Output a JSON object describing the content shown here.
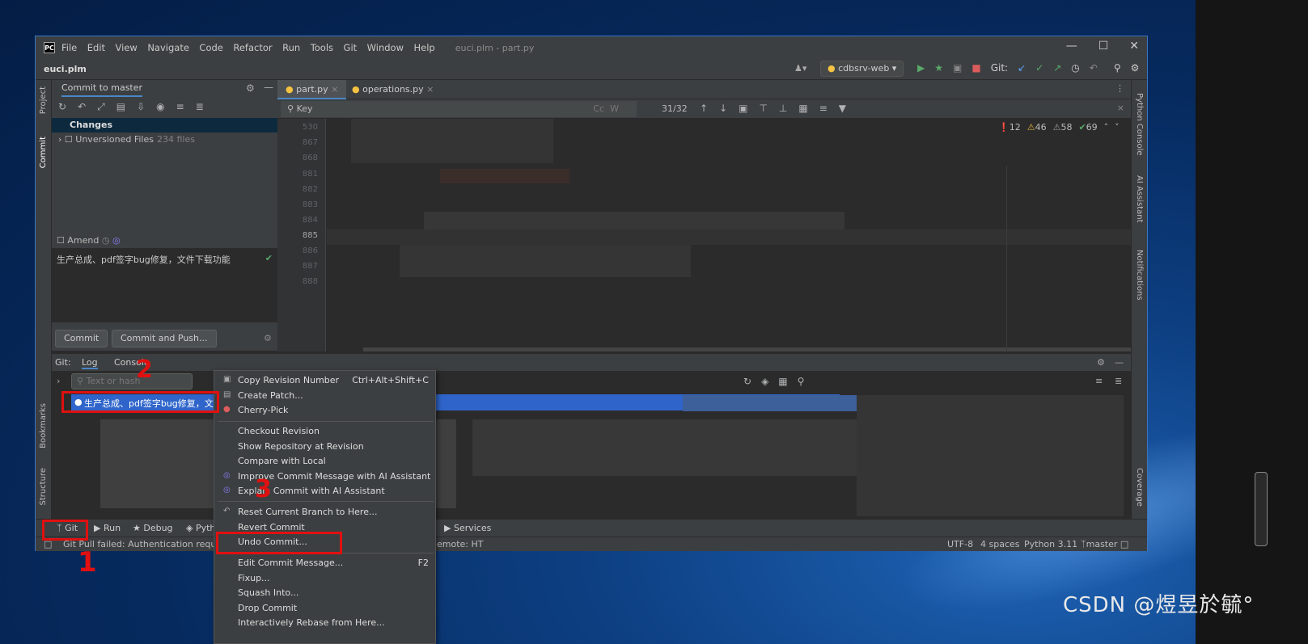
{
  "window": {
    "title": "euci.plm - part.py",
    "menu": [
      "File",
      "Edit",
      "View",
      "Navigate",
      "Code",
      "Refactor",
      "Run",
      "Tools",
      "Git",
      "Window",
      "Help"
    ]
  },
  "nav": {
    "project": "euci.plm",
    "run_config": "cdbsrv-web",
    "git_label": "Git:"
  },
  "commit": {
    "panel_title": "Commit to master",
    "changes_label": "Changes",
    "unversioned_label": "Unversioned Files",
    "unversioned_count": "234 files",
    "amend_label": "Amend",
    "message": "生产总成、pdf签字bug修复，文件下载功能",
    "commit_btn": "Commit",
    "commit_push_btn": "Commit and Push..."
  },
  "left_stripe": {
    "project": "Project",
    "commit": "Commit",
    "bookmarks": "Bookmarks",
    "structure": "Structure"
  },
  "right_stripe": {
    "python_console": "Python Console",
    "ai": "AI Assistant",
    "notifications": "Notifications",
    "coverage": "Coverage"
  },
  "editor": {
    "tabs": [
      "part.py",
      "operations.py"
    ],
    "search_text": "Key",
    "search_count": "31/32",
    "line_numbers": [
      "530",
      "867",
      "868",
      "881",
      "882",
      "883",
      "884",
      "885",
      "886",
      "887",
      "888"
    ],
    "errors": "12",
    "warnings": "46",
    "weak": "58",
    "ok": "69"
  },
  "git": {
    "label": "Git:",
    "tab_log": "Log",
    "tab_console": "Console",
    "filter_placeholder": "Text or hash",
    "selected_commit": "生产总成、pdf签字bug修复，文"
  },
  "context_menu": {
    "items": [
      {
        "label": "Copy Revision Number",
        "shortcut": "Ctrl+Alt+Shift+C",
        "icon": "copy-icon"
      },
      {
        "label": "Create Patch...",
        "shortcut": "",
        "icon": "patch-icon"
      },
      {
        "label": "Cherry-Pick",
        "shortcut": "",
        "icon": "cherry-icon"
      },
      {
        "label": "Checkout Revision",
        "shortcut": "",
        "icon": ""
      },
      {
        "label": "Show Repository at Revision",
        "shortcut": "",
        "icon": ""
      },
      {
        "label": "Compare with Local",
        "shortcut": "",
        "icon": ""
      },
      {
        "label": "Improve Commit Message with AI Assistant",
        "shortcut": "",
        "icon": "ai-icon"
      },
      {
        "label": "Explain Commit with AI Assistant",
        "shortcut": "",
        "icon": "ai-icon"
      },
      {
        "label": "Reset Current Branch to Here...",
        "shortcut": "",
        "icon": "reset-icon"
      },
      {
        "label": "Revert Commit",
        "shortcut": "",
        "icon": ""
      },
      {
        "label": "Undo Commit...",
        "shortcut": "",
        "icon": ""
      },
      {
        "label": "Edit Commit Message...",
        "shortcut": "F2",
        "icon": ""
      },
      {
        "label": "Fixup...",
        "shortcut": "",
        "icon": ""
      },
      {
        "label": "Squash Into...",
        "shortcut": "",
        "icon": ""
      },
      {
        "label": "Drop Commit",
        "shortcut": "",
        "icon": ""
      },
      {
        "label": "Interactively Rebase from Here...",
        "shortcut": "",
        "icon": ""
      }
    ]
  },
  "toolwindows": {
    "git": "Git",
    "run": "Run",
    "debug": "Debug",
    "python": "Pyth",
    "services": "Services"
  },
  "status": {
    "message": "Git Pull failed: Authentication request",
    "remote": "emote: HT",
    "indent": "4 spaces",
    "interpreter": "Python 3.11",
    "branch": "master",
    "encoding": "UTF-8"
  },
  "annotations": {
    "mark1": "1",
    "mark2": "2",
    "mark3": "3"
  },
  "watermark": "CSDN @煜昱於毓°",
  "colors": {
    "accent": "#2f65ca",
    "annotation": "#e01010",
    "success": "#59a869",
    "error": "#db5c5c"
  }
}
